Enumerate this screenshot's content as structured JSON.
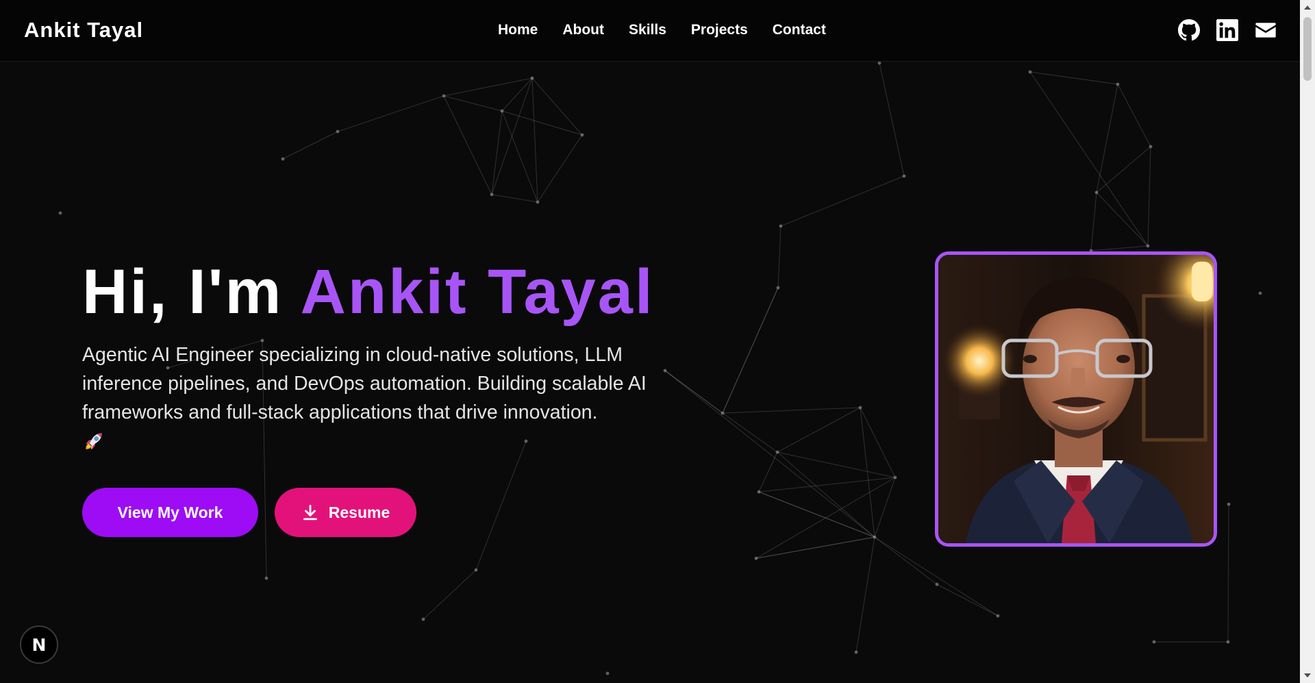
{
  "nav": {
    "brand": "Ankit Tayal",
    "links": [
      "Home",
      "About",
      "Skills",
      "Projects",
      "Contact"
    ],
    "social_icons": [
      "github-icon",
      "linkedin-icon",
      "mail-icon"
    ]
  },
  "hero": {
    "greeting": "Hi, I'm ",
    "name": "Ankit Tayal",
    "description": "Agentic AI Engineer specializing in cloud-native solutions, LLM inference pipelines, and DevOps automation. Building scalable AI frameworks and full-stack applications that drive innovation.",
    "emoji_icon": "rocket-icon",
    "primary_button": "View My Work",
    "secondary_button": "Resume",
    "secondary_button_icon": "download-icon"
  },
  "profile": {
    "image": "profile-photo"
  },
  "badge": {
    "label": "N"
  },
  "colors": {
    "accent": "#a855f7",
    "primary_button": "#9d0cf5",
    "secondary_button": "#e3127a",
    "background": "#0a0a0a",
    "navbar": "#050505"
  }
}
